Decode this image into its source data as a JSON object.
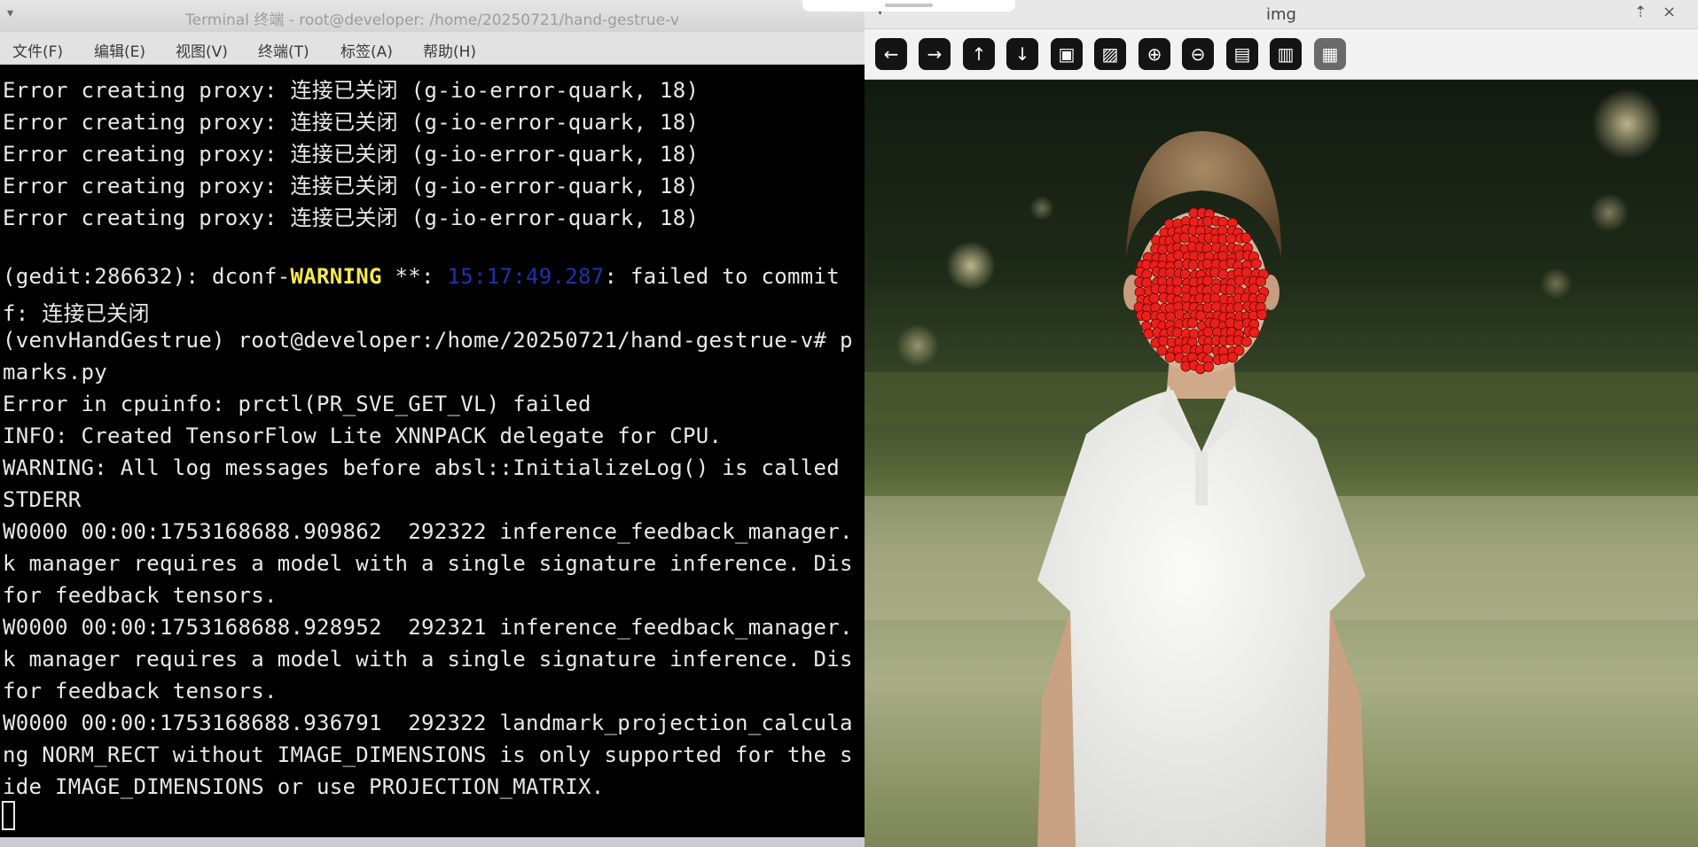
{
  "terminal": {
    "title": "Terminal 终端 - root@developer: /home/20250721/hand-gestrue-v",
    "menu": [
      "文件(F)",
      "编辑(E)",
      "视图(V)",
      "终端(T)",
      "标签(A)",
      "帮助(H)"
    ],
    "lines": [
      "Error creating proxy: 连接已关闭 (g-io-error-quark, 18)",
      "Error creating proxy: 连接已关闭 (g-io-error-quark, 18)",
      "Error creating proxy: 连接已关闭 (g-io-error-quark, 18)",
      "Error creating proxy: 连接已关闭 (g-io-error-quark, 18)",
      "Error creating proxy: 连接已关闭 (g-io-error-quark, 18)",
      "",
      "",
      "f: 连接已关闭",
      "(venvHandGestrue) root@developer:/home/20250721/hand-gestrue-v# p",
      "marks.py",
      "Error in cpuinfo: prctl(PR_SVE_GET_VL) failed",
      "INFO: Created TensorFlow Lite XNNPACK delegate for CPU.",
      "WARNING: All log messages before absl::InitializeLog() is called",
      "STDERR",
      "W0000 00:00:1753168688.909862  292322 inference_feedback_manager.",
      "k manager requires a model with a single signature inference. Dis",
      "for feedback tensors.",
      "W0000 00:00:1753168688.928952  292321 inference_feedback_manager.",
      "k manager requires a model with a single signature inference. Dis",
      "for feedback tensors.",
      "W0000 00:00:1753168688.936791  292322 landmark_projection_calcula",
      "ng NORM_RECT without IMAGE_DIMENSIONS is only supported for the s",
      "ide IMAGE_DIMENSIONS or use PROJECTION_MATRIX."
    ],
    "dconf": {
      "prefix": "(gedit:286632): dconf-",
      "level": "WARNING",
      "stars": " **: ",
      "timestamp": "15:17:49.287",
      "message": ": failed to commit"
    }
  },
  "img_window": {
    "title": "img",
    "toolbar_icons": [
      "arrow-left-icon",
      "arrow-right-icon",
      "arrow-up-icon",
      "arrow-down-icon",
      "image-icon",
      "image-settings-icon",
      "zoom-in-icon",
      "zoom-out-icon",
      "save-icon",
      "clipboard-icon",
      "paint-icon"
    ],
    "toolbar_glyphs": [
      "←",
      "→",
      "↑",
      "↓",
      "▣",
      "▨",
      "⊕",
      "⊖",
      "▤",
      "▥",
      "▦"
    ],
    "photo_description_colors": {
      "landmark": "#e8211c",
      "shirt": "#f1f1ef",
      "hair": "#8a6a48"
    }
  }
}
